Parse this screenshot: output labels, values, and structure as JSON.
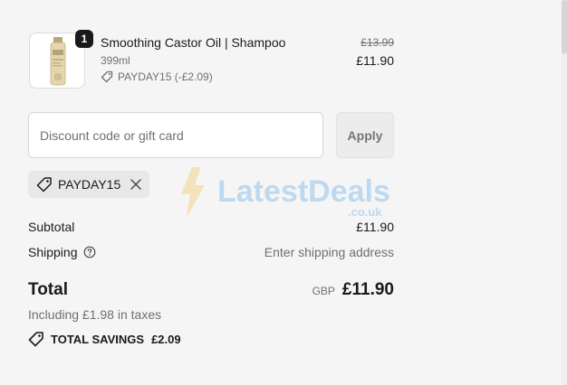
{
  "product": {
    "name": "Smoothing Castor Oil | Shampoo",
    "variant": "399ml",
    "discount_line": "PAYDAY15 (-£2.09)",
    "original_price": "£13.99",
    "price": "£11.90",
    "quantity": "1",
    "image_icon": "shampoo-bottle-icon"
  },
  "discount": {
    "placeholder": "Discount code or gift card",
    "value": "",
    "apply_label": "Apply",
    "applied_code": "PAYDAY15"
  },
  "watermark": {
    "text": "LatestDeals",
    "sub": ".co.uk"
  },
  "summary": {
    "subtotal_label": "Subtotal",
    "subtotal_value": "£11.90",
    "shipping_label": "Shipping",
    "shipping_value": "Enter shipping address",
    "total_label": "Total",
    "currency": "GBP",
    "total_value": "£11.90",
    "taxes_note": "Including £1.98 in taxes",
    "savings_label": "TOTAL SAVINGS",
    "savings_value": "£2.09"
  },
  "colors": {
    "background": "#f5f5f5",
    "text": "#1a1a1a",
    "muted": "#707070",
    "chip": "#e8e8e8"
  }
}
